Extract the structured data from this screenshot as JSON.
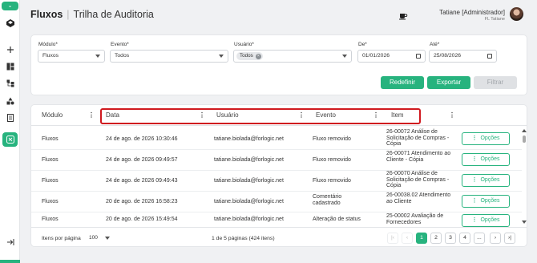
{
  "app": {
    "title": "Fluxos",
    "subtitle": "Trilha de Auditoria"
  },
  "user": {
    "name": "Tatiane [Administrador]",
    "org": "FL Tatiane"
  },
  "sidebar": {
    "items": [
      "chevron-down-icon",
      "logo-icon",
      "add-icon",
      "dashboard-icon",
      "hierarchy-icon",
      "shapes-icon",
      "document-icon",
      "flow-icon",
      "collapse-icon"
    ],
    "active": "flow-icon"
  },
  "filters": {
    "modulo": {
      "label": "Módulo*",
      "value": "Fluxos"
    },
    "evento": {
      "label": "Evento*",
      "value": "Todos"
    },
    "usuario": {
      "label": "Usuário*",
      "chip": "Todos"
    },
    "de": {
      "label": "De*",
      "value": "01/01/2026"
    },
    "ate": {
      "label": "Até*",
      "value": "25/08/2026"
    },
    "buttons": {
      "redefinir": "Redefinir",
      "exportar": "Exportar",
      "filtrar": "Filtrar"
    }
  },
  "table": {
    "columns": [
      "Módulo",
      "Data",
      "Usuário",
      "Evento",
      "Item"
    ],
    "rows": [
      {
        "modulo": "Fluxos",
        "data": "24 de ago. de 2026 10:30:46",
        "usuario": "tatiane.biolada@forlogic.net",
        "evento": "Fluxo removido",
        "item": "26-00072 Análise de Solicitação de Compras - Cópia"
      },
      {
        "modulo": "Fluxos",
        "data": "24 de ago. de 2026 09:49:57",
        "usuario": "tatiane.biolada@forlogic.net",
        "evento": "Fluxo removido",
        "item": "26-00071 Atendimento ao Cliente - Cópia"
      },
      {
        "modulo": "Fluxos",
        "data": "24 de ago. de 2026 09:49:43",
        "usuario": "tatiane.biolada@forlogic.net",
        "evento": "Fluxo removido",
        "item": "26-00070 Análise de Solicitação de Compras - Cópia"
      },
      {
        "modulo": "Fluxos",
        "data": "20 de ago. de 2026 16:58:23",
        "usuario": "tatiane.biolada@forlogic.net",
        "evento": "Comentário cadastrado",
        "item": "26-00038.02 Atendimento ao Cliente"
      },
      {
        "modulo": "Fluxos",
        "data": "20 de ago. de 2026 15:49:54",
        "usuario": "tatiane.biolada@forlogic.net",
        "evento": "Alteração de status",
        "item": "25-00002 Avaliação de Fornecedores"
      }
    ],
    "options_label": "Opções"
  },
  "pagination": {
    "per_page_label": "Itens por página",
    "per_page_value": "100",
    "info": "1 de 5 páginas (424 itens)",
    "first": "|‹",
    "prev": "‹",
    "pages": [
      "1",
      "2",
      "3",
      "4",
      "..."
    ],
    "next": "›",
    "last": "›|",
    "current": "1"
  },
  "colors": {
    "accent": "#27b37e",
    "highlight_border": "#d0191f"
  }
}
